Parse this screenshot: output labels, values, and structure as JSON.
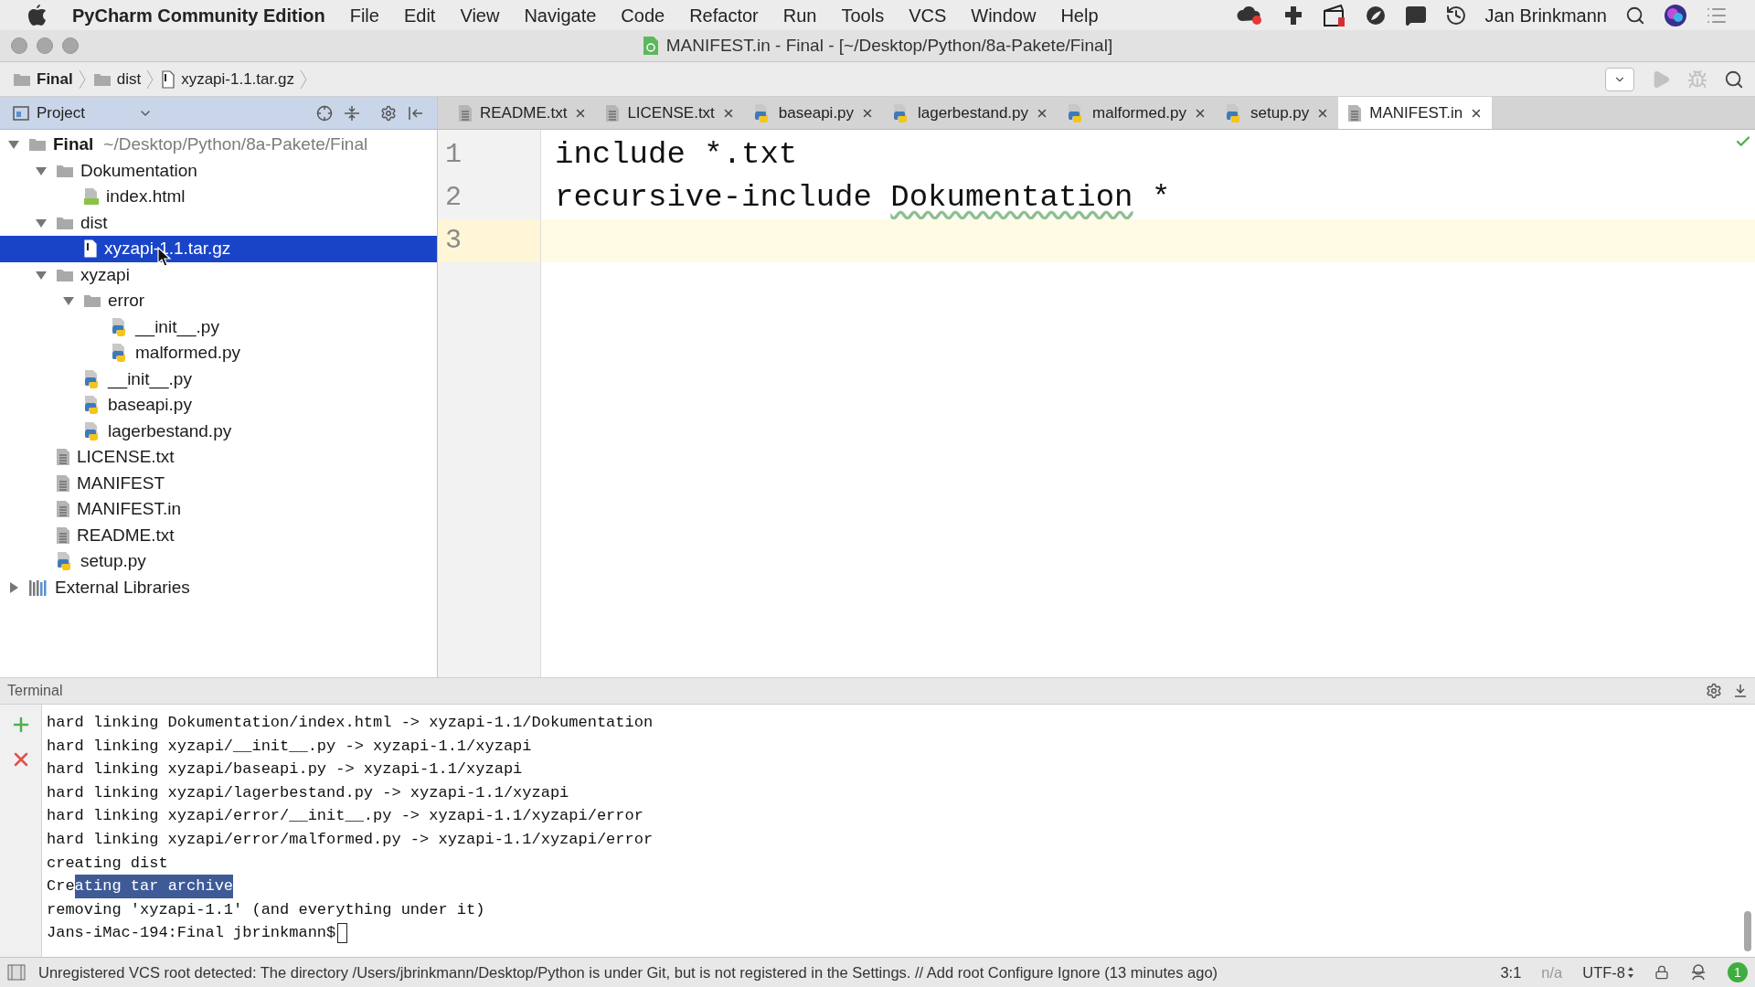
{
  "menu_bar": {
    "app_name": "PyCharm Community Edition",
    "menus": [
      "File",
      "Edit",
      "View",
      "Navigate",
      "Code",
      "Refactor",
      "Run",
      "Tools",
      "VCS",
      "Window",
      "Help"
    ],
    "user": "Jan Brinkmann"
  },
  "window": {
    "title": "MANIFEST.in - Final - [~/Desktop/Python/8a-Pakete/Final]"
  },
  "breadcrumbs": [
    {
      "label": "Final",
      "kind": "folder"
    },
    {
      "label": "dist",
      "kind": "folder"
    },
    {
      "label": "xyzapi-1.1.tar.gz",
      "kind": "archive"
    }
  ],
  "project_panel": {
    "title": "Project",
    "tree": [
      {
        "label": "Final",
        "path": "~/Desktop/Python/8a-Pakete/Final",
        "kind": "folder",
        "expanded": true,
        "selected": false,
        "children": [
          {
            "label": "Dokumentation",
            "kind": "folder",
            "expanded": true,
            "selected": false,
            "children": [
              {
                "label": "index.html",
                "kind": "html",
                "selected": false
              }
            ]
          },
          {
            "label": "dist",
            "kind": "folder",
            "expanded": true,
            "selected": false,
            "children": [
              {
                "label": "xyzapi-1.1.tar.gz",
                "kind": "archive",
                "selected": true
              }
            ]
          },
          {
            "label": "xyzapi",
            "kind": "folder",
            "expanded": true,
            "selected": false,
            "children": [
              {
                "label": "error",
                "kind": "folder",
                "expanded": true,
                "selected": false,
                "children": [
                  {
                    "label": "__init__.py",
                    "kind": "python",
                    "selected": false
                  },
                  {
                    "label": "malformed.py",
                    "kind": "python",
                    "selected": false
                  }
                ]
              },
              {
                "label": "__init__.py",
                "kind": "python",
                "selected": false
              },
              {
                "label": "baseapi.py",
                "kind": "python",
                "selected": false
              },
              {
                "label": "lagerbestand.py",
                "kind": "python",
                "selected": false
              }
            ]
          },
          {
            "label": "LICENSE.txt",
            "kind": "text",
            "selected": false
          },
          {
            "label": "MANIFEST",
            "kind": "text",
            "selected": false
          },
          {
            "label": "MANIFEST.in",
            "kind": "text",
            "selected": false
          },
          {
            "label": "README.txt",
            "kind": "text",
            "selected": false
          },
          {
            "label": "setup.py",
            "kind": "python",
            "selected": false
          }
        ]
      },
      {
        "label": "External Libraries",
        "kind": "library",
        "expanded": false,
        "selected": false
      }
    ]
  },
  "tabs": [
    {
      "label": "README.txt",
      "kind": "text",
      "selected": false
    },
    {
      "label": "LICENSE.txt",
      "kind": "text",
      "selected": false
    },
    {
      "label": "baseapi.py",
      "kind": "python",
      "selected": false
    },
    {
      "label": "lagerbestand.py",
      "kind": "python",
      "selected": false
    },
    {
      "label": "malformed.py",
      "kind": "python",
      "selected": false
    },
    {
      "label": "setup.py",
      "kind": "python",
      "selected": false
    },
    {
      "label": "MANIFEST.in",
      "kind": "text",
      "selected": true
    }
  ],
  "editor": {
    "lines": [
      {
        "number": "1",
        "current": false,
        "segments": [
          {
            "text": "include *.txt",
            "misspelled": false
          }
        ]
      },
      {
        "number": "2",
        "current": false,
        "segments": [
          {
            "text": "recursive-include ",
            "misspelled": false
          },
          {
            "text": "Dokumentation",
            "misspelled": true
          },
          {
            "text": " *",
            "misspelled": false
          }
        ]
      },
      {
        "number": "3",
        "current": true
      }
    ]
  },
  "terminal": {
    "title": "Terminal",
    "lines": [
      {
        "segments": [
          {
            "text": "hard linking Dokumentation/index.html -> xyzapi-1.1/Dokumentation",
            "selected": false
          }
        ]
      },
      {
        "segments": [
          {
            "text": "hard linking xyzapi/__init__.py -> xyzapi-1.1/xyzapi",
            "selected": false
          }
        ]
      },
      {
        "segments": [
          {
            "text": "hard linking xyzapi/baseapi.py -> xyzapi-1.1/xyzapi",
            "selected": false
          }
        ]
      },
      {
        "segments": [
          {
            "text": "hard linking xyzapi/lagerbestand.py -> xyzapi-1.1/xyzapi",
            "selected": false
          }
        ]
      },
      {
        "segments": [
          {
            "text": "hard linking xyzapi/error/__init__.py -> xyzapi-1.1/xyzapi/error",
            "selected": false
          }
        ]
      },
      {
        "segments": [
          {
            "text": "hard linking xyzapi/error/malformed.py -> xyzapi-1.1/xyzapi/error",
            "selected": false
          }
        ]
      },
      {
        "segments": [
          {
            "text": "creating dist",
            "selected": false
          }
        ]
      },
      {
        "segments": [
          {
            "text": "Cre",
            "selected": false
          },
          {
            "text": "ating tar archive",
            "selected": true
          }
        ]
      },
      {
        "segments": [
          {
            "text": "removing 'xyzapi-1.1' (and everything under it)",
            "selected": false
          }
        ]
      },
      {
        "segments": [
          {
            "text": "Jans-iMac-194:Final jbrinkmann$",
            "selected": false
          }
        ],
        "cursor": true
      }
    ]
  },
  "status_bar": {
    "message": "Unregistered VCS root detected: The directory /Users/jbrinkmann/Desktop/Python is under Git, but is not registered in the Settings. // Add root Configure Ignore (13 minutes ago)",
    "position": "3:1",
    "readonly": "n/a",
    "encoding": "UTF-8",
    "notifications": "1"
  }
}
